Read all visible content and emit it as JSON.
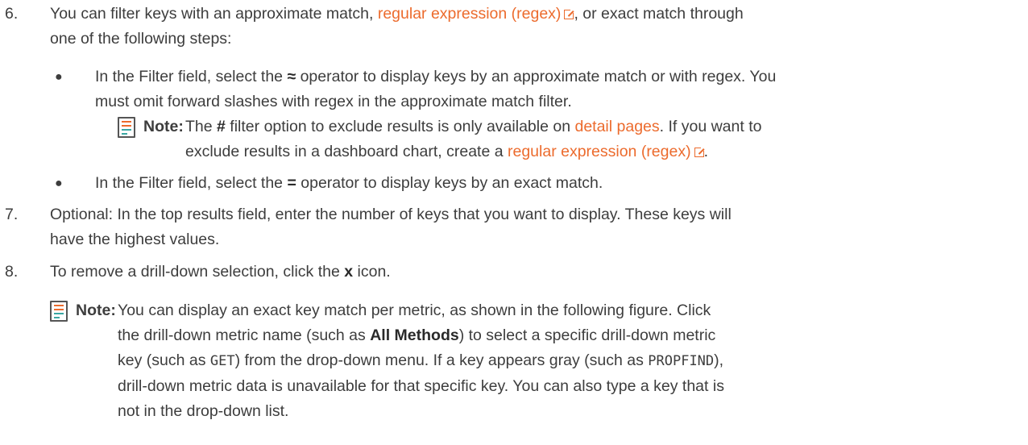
{
  "colors": {
    "link": "#ec6b2d",
    "text": "#3d3d3d",
    "note_icon_orange": "#ec6b2d",
    "note_icon_teal": "#3aa7a3"
  },
  "step6": {
    "number": "6.",
    "text_before_link": "You can filter keys with an approximate match, ",
    "link_text": "regular expression (regex)",
    "text_after_link": ", or exact match through",
    "line2": "one of the following steps:",
    "bullet1": {
      "before_op": "In the Filter field, select the ",
      "operator": "≈",
      "after_op": " operator to display keys by an approximate match or with regex. You",
      "line2": "must omit forward slashes with regex in the approximate match filter."
    },
    "note": {
      "label": "Note:",
      "text_a": "The ",
      "hash": "#",
      "text_b": " filter option to exclude results is only available on ",
      "link1": "detail pages",
      "text_c": ". If you want to",
      "line2_a": "exclude results in a dashboard chart, create a ",
      "link2": "regular expression (regex)",
      "line2_b": "."
    },
    "bullet2": {
      "before_op": "In the Filter field, select the ",
      "operator": "=",
      "after_op": " operator to display keys by an exact match."
    }
  },
  "step7": {
    "number": "7.",
    "line1": "Optional: In the top results field, enter the number of keys that you want to display. These keys will",
    "line2": "have the highest values."
  },
  "step8": {
    "number": "8.",
    "text_a": "To remove a drill-down selection, click the ",
    "x": "x",
    "text_b": " icon.",
    "note": {
      "label": "Note:",
      "line1": "You can display an exact key match per metric, as shown in the following figure. Click",
      "line2_a": "the drill-down metric name (such as ",
      "line2_bold": "All Methods",
      "line2_b": ") to select a specific drill-down metric",
      "line3_a": "key (such as ",
      "line3_mono": "GET",
      "line3_b": ") from the drop-down menu. If a key appears gray (such as ",
      "line3_mono2": "PROPFIND",
      "line3_c": "),",
      "line4": "drill-down metric data is unavailable for that specific key. You can also type a key that is",
      "line5": "not in the drop-down list."
    }
  }
}
